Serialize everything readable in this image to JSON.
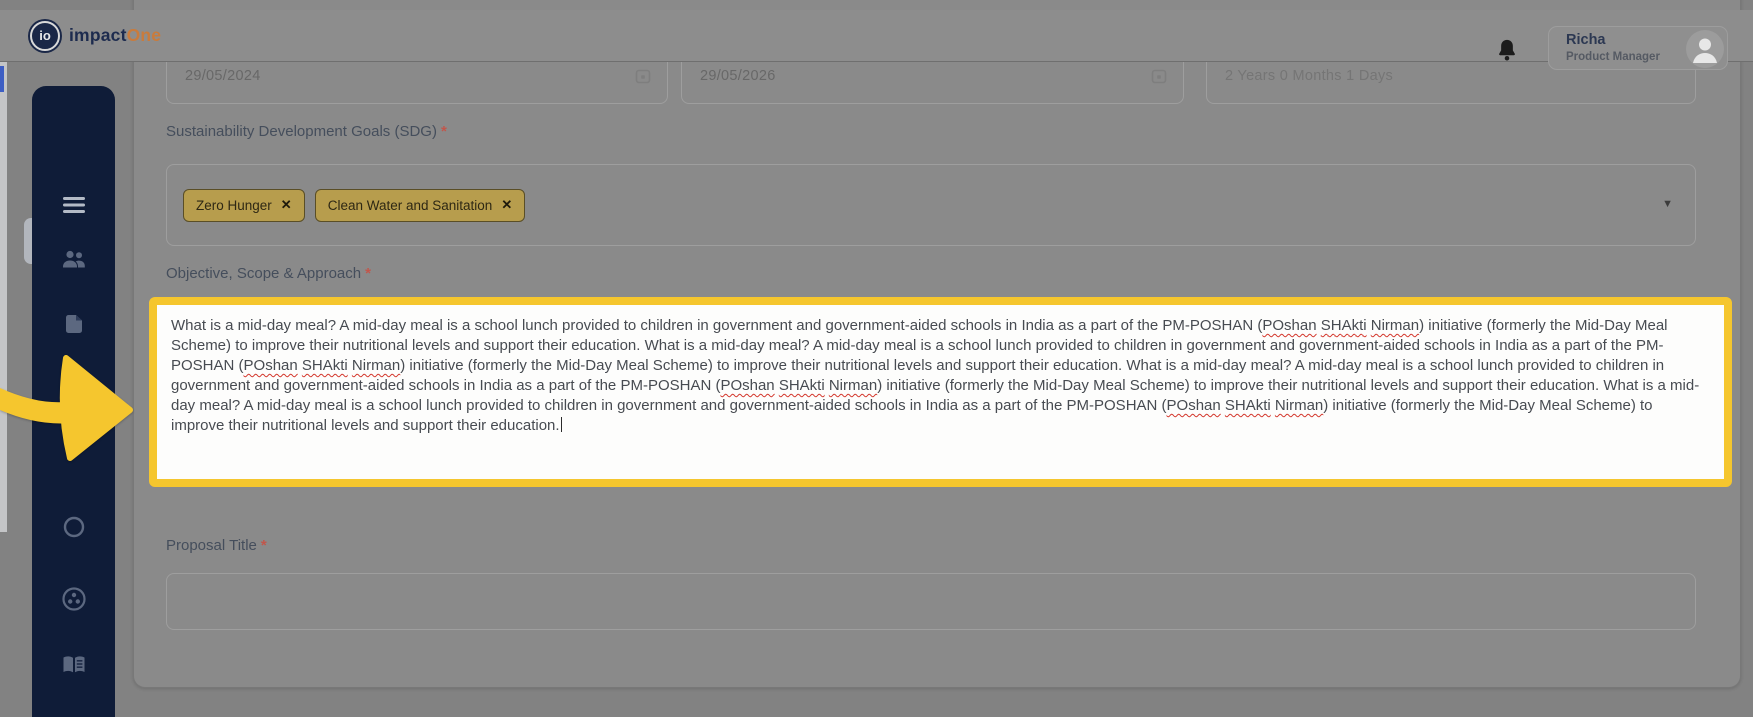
{
  "header": {
    "brand": {
      "logo_initials": "io",
      "name_prefix": "impact",
      "name_suffix": "One"
    },
    "user": {
      "name": "Richa",
      "role": "Product Manager"
    }
  },
  "sidebar": {
    "items": [
      {
        "icon": "menu-icon"
      },
      {
        "icon": "users-icon"
      },
      {
        "icon": "file-icon"
      },
      {
        "icon": "notebook-icon"
      },
      {
        "icon": "globe-icon"
      },
      {
        "icon": "group-circle-icon"
      },
      {
        "icon": "open-book-icon"
      }
    ]
  },
  "form": {
    "start_date": {
      "value": "29/05/2024"
    },
    "end_date": {
      "value": "29/05/2026"
    },
    "duration": {
      "value": "2 Years 0 Months 1 Days"
    },
    "sdg": {
      "label": "Sustainability Development Goals (SDG)",
      "required": "*",
      "chips": [
        "Zero Hunger",
        "Clean Water and Sanitation"
      ],
      "remove_icon": "✕",
      "dropdown_icon": "▼"
    },
    "objective": {
      "label": "Objective, Scope & Approach",
      "required": "*",
      "value": "What is a mid-day meal? A mid-day meal is a school lunch provided to children in government and government-aided schools in India as a part of the PM-POSHAN (POshan SHAkti Nirman) initiative (formerly the Mid-Day Meal Scheme) to improve their nutritional levels and support their education. What is a mid-day meal? A mid-day meal is a school lunch provided to children in government and government-aided schools in India as a part of the PM-POSHAN (POshan SHAkti Nirman) initiative (formerly the Mid-Day Meal Scheme) to improve their nutritional levels and support their education. What is a mid-day meal? A mid-day meal is a school lunch provided to children in government and government-aided schools in India as a part of the PM-POSHAN (POshan SHAkti Nirman) initiative (formerly the Mid-Day Meal Scheme) to improve their nutritional levels and support their education. What is a mid-day meal? A mid-day meal is a school lunch provided to children in government and government-aided schools in India as a part of the PM-POSHAN (POshan SHAkti Nirman) initiative (formerly the Mid-Day Meal Scheme) to improve their nutritional levels and support their education.",
      "misspelled": [
        "POshan",
        "SHAkti",
        "Nirman"
      ]
    },
    "proposal_title": {
      "label": "Proposal Title",
      "required": "*",
      "value": ""
    }
  },
  "colors": {
    "brand_navy": "#1d2b4e",
    "brand_orange": "#c97b3c",
    "sidebar_bg": "#0f1c38",
    "highlight_yellow": "#f5c62e",
    "chip_gold": "#b79d4d",
    "required_red": "#c2564b"
  }
}
